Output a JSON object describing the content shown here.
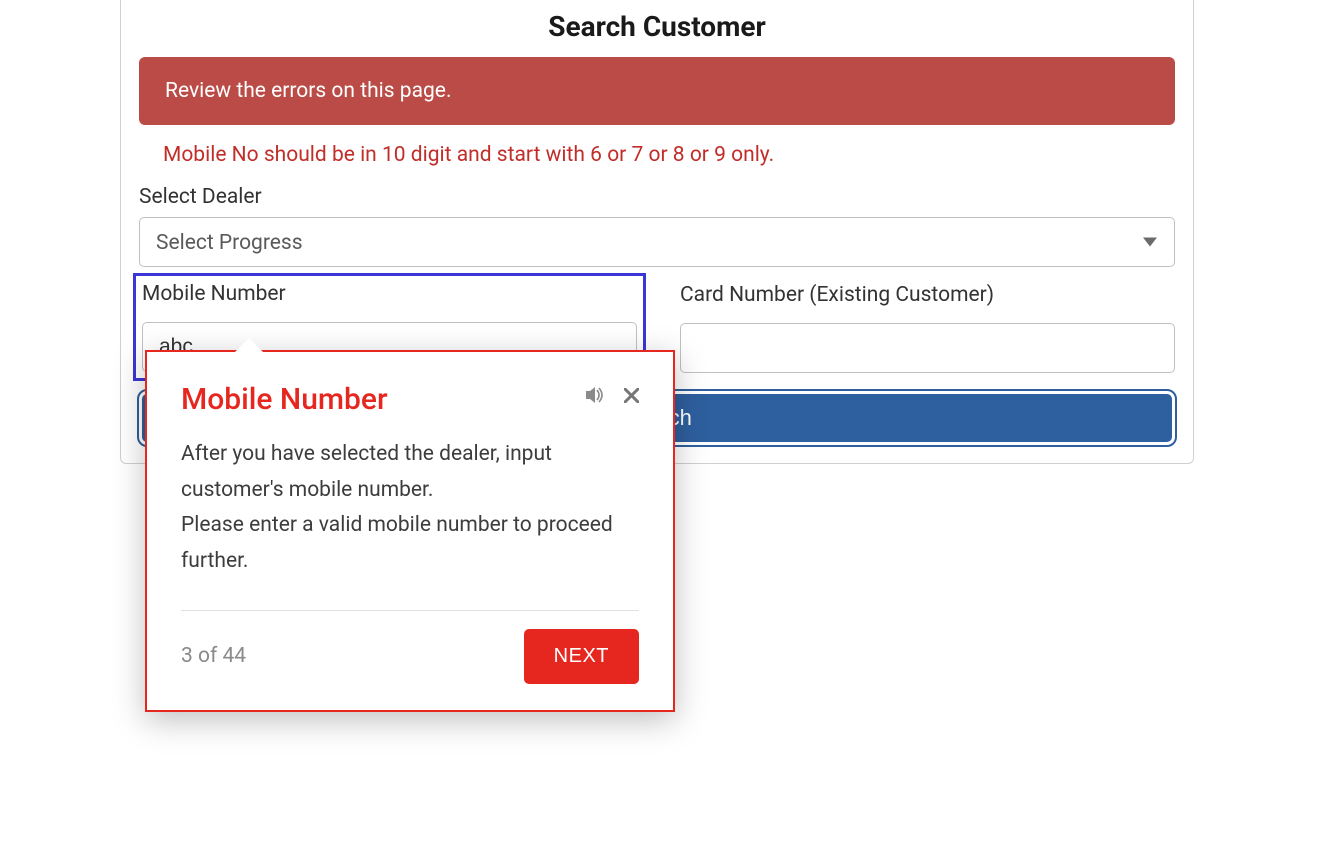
{
  "page": {
    "title": "Search Customer"
  },
  "alert": {
    "message": "Review the errors on this page."
  },
  "validation": {
    "mobile_error": "Mobile No should be in 10 digit and start with 6 or 7 or 8 or 9 only."
  },
  "form": {
    "dealer_label": "Select Dealer",
    "dealer_value": "Select Progress",
    "mobile_label": "Mobile Number",
    "mobile_value": "abc",
    "card_label": "Card Number (Existing Customer)",
    "card_value": "",
    "search_button": "Search"
  },
  "popover": {
    "title": "Mobile Number",
    "body_line1": "After you have selected the dealer, input customer's mobile number.",
    "body_line2": "Please enter a valid mobile number to proceed further.",
    "step": "3 of 44",
    "next_button": "NEXT"
  }
}
